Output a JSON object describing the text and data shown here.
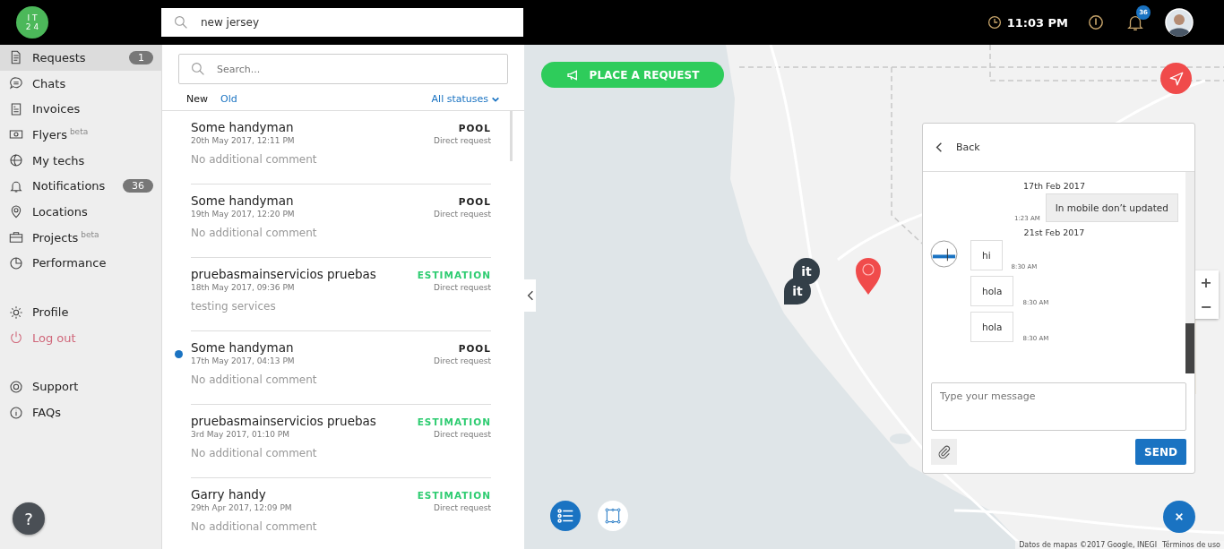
{
  "header": {
    "logo": [
      "IT",
      "24"
    ],
    "search": {
      "value": "new jersey"
    },
    "time": "11:03 PM",
    "notifications_badge": "36"
  },
  "sidebar": {
    "groups": [
      [
        {
          "label": "Requests",
          "selected": true,
          "badge": "1"
        },
        {
          "label": "Chats",
          "selected": false
        },
        {
          "label": "Invoices",
          "selected": false
        },
        {
          "label": "Flyers",
          "selected": false,
          "sup": "beta"
        },
        {
          "label": "My techs",
          "selected": false
        },
        {
          "label": "Notifications",
          "selected": false,
          "badge": "36"
        },
        {
          "label": "Locations",
          "selected": false
        },
        {
          "label": "Projects",
          "selected": false,
          "sup": "beta"
        },
        {
          "label": "Performance",
          "selected": false
        }
      ],
      [
        {
          "label": "Profile",
          "selected": false,
          "kind": "normal"
        },
        {
          "label": "Log out",
          "selected": false,
          "kind": "danger"
        }
      ],
      [
        {
          "label": "Support",
          "selected": false
        },
        {
          "label": "FAQs",
          "selected": false
        }
      ]
    ],
    "help": "?"
  },
  "requests": {
    "search": {
      "placeholder": "Search..."
    },
    "tabs": [
      {
        "label": "New",
        "selected": true
      },
      {
        "label": "Old",
        "selected": false
      }
    ],
    "filter": "All statuses",
    "items": [
      {
        "title": "Some handyman",
        "date": "20th May 2017, 12:11 PM",
        "status": "POOL",
        "kind": "pool",
        "source": "Direct request",
        "comment": "No additional comment",
        "unread": false
      },
      {
        "title": "Some handyman",
        "date": "19th May 2017, 12:20 PM",
        "status": "POOL",
        "kind": "pool",
        "source": "Direct request",
        "comment": "No additional comment",
        "unread": false
      },
      {
        "title": "pruebasmainservicios pruebas",
        "date": "18th May 2017, 09:36 PM",
        "status": "ESTIMATION",
        "kind": "estimation",
        "source": "Direct request",
        "comment": "testing services",
        "unread": false
      },
      {
        "title": "Some handyman",
        "date": "17th May 2017, 04:13 PM",
        "status": "POOL",
        "kind": "pool",
        "source": "Direct request",
        "comment": "No additional comment",
        "unread": true
      },
      {
        "title": "pruebasmainservicios pruebas",
        "date": "3rd May 2017, 01:10 PM",
        "status": "ESTIMATION",
        "kind": "estimation",
        "source": "Direct request",
        "comment": "No additional comment",
        "unread": false
      },
      {
        "title": "Garry handy",
        "date": "29th Apr 2017, 12:09 PM",
        "status": "ESTIMATION",
        "kind": "estimation",
        "source": "Direct request",
        "comment": "No additional comment",
        "unread": false
      }
    ]
  },
  "map": {
    "place_request": "PLACE A REQUEST",
    "markers": [
      {
        "kind": "tech",
        "label": "it"
      },
      {
        "kind": "tech",
        "label": "it"
      },
      {
        "kind": "request"
      }
    ],
    "zoom_in": "+",
    "zoom_out": "−",
    "attribution": "Datos de mapas ©2017 Google, INEGI",
    "terms": "Términos de uso"
  },
  "chat": {
    "back": "Back",
    "messages": [
      {
        "kind": "date",
        "text": "17th Feb 2017"
      },
      {
        "kind": "outgoing",
        "text": "In mobile don’t updated",
        "time": "1:23 AM"
      },
      {
        "kind": "date",
        "text": "21st Feb 2017"
      },
      {
        "kind": "incoming",
        "text": "hi",
        "time": "8:30 AM",
        "avatar": true
      },
      {
        "kind": "incoming",
        "text": "hola",
        "time": "8:30 AM",
        "avatar": false
      },
      {
        "kind": "incoming",
        "text": "hola",
        "time": "8:30 AM",
        "avatar": false
      }
    ],
    "input": {
      "placeholder": "Type your message"
    },
    "send": "SEND"
  }
}
